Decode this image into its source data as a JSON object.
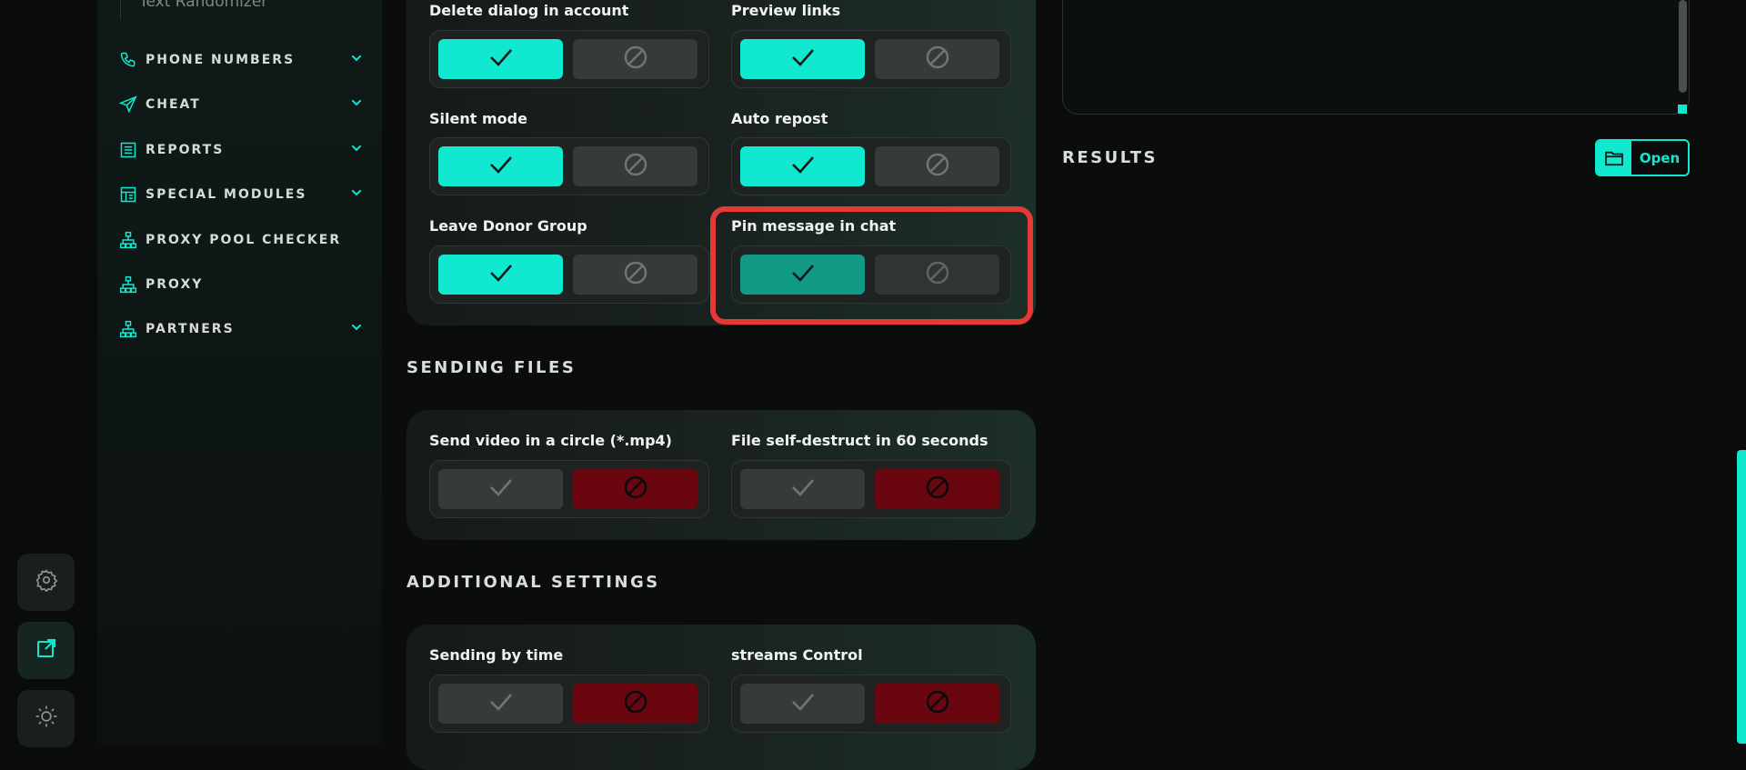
{
  "colors": {
    "accent": "#10e8d0",
    "accent_dim": "#139a86",
    "danger": "#6a0610",
    "highlight": "#e53935"
  },
  "rail": {
    "items": [
      {
        "icon": "gear-icon"
      },
      {
        "icon": "external-link-icon"
      },
      {
        "icon": "sun-icon"
      }
    ]
  },
  "sidebar": {
    "sub_item": "Text Randomizer",
    "items": [
      {
        "label": "PHONE NUMBERS",
        "icon": "phone-icon",
        "chevron": true
      },
      {
        "label": "CHEAT",
        "icon": "send-icon",
        "chevron": true
      },
      {
        "label": "REPORTS",
        "icon": "report-icon",
        "chevron": true
      },
      {
        "label": "SPECIAL MODULES",
        "icon": "modules-icon",
        "chevron": true
      },
      {
        "label": "PROXY POOL CHECKER",
        "icon": "network-icon",
        "chevron": false
      },
      {
        "label": "PROXY",
        "icon": "network-icon",
        "chevron": false
      },
      {
        "label": "PARTNERS",
        "icon": "network-icon",
        "chevron": true
      }
    ]
  },
  "options": {
    "delete_dialog": {
      "label": "Delete dialog in account",
      "state": "on"
    },
    "preview_links": {
      "label": "Preview links",
      "state": "on"
    },
    "silent_mode": {
      "label": "Silent mode",
      "state": "on"
    },
    "auto_repost": {
      "label": "Auto repost",
      "state": "on"
    },
    "leave_donor": {
      "label": "Leave Donor Group",
      "state": "on"
    },
    "pin_message": {
      "label": "Pin message in chat",
      "state": "on"
    }
  },
  "sending_files": {
    "title": "SENDING FILES",
    "video_circle": {
      "label": "Send video in a circle (*.mp4)",
      "state": "off"
    },
    "self_destruct": {
      "label": "File self-destruct in 60 seconds",
      "state": "off"
    }
  },
  "additional": {
    "title": "ADDITIONAL SETTINGS",
    "sending_time": {
      "label": "Sending by time",
      "state": "off"
    },
    "streams": {
      "label": "streams Control",
      "state": "off"
    }
  },
  "results": {
    "title": "RESULTS",
    "open_label": "Open"
  }
}
